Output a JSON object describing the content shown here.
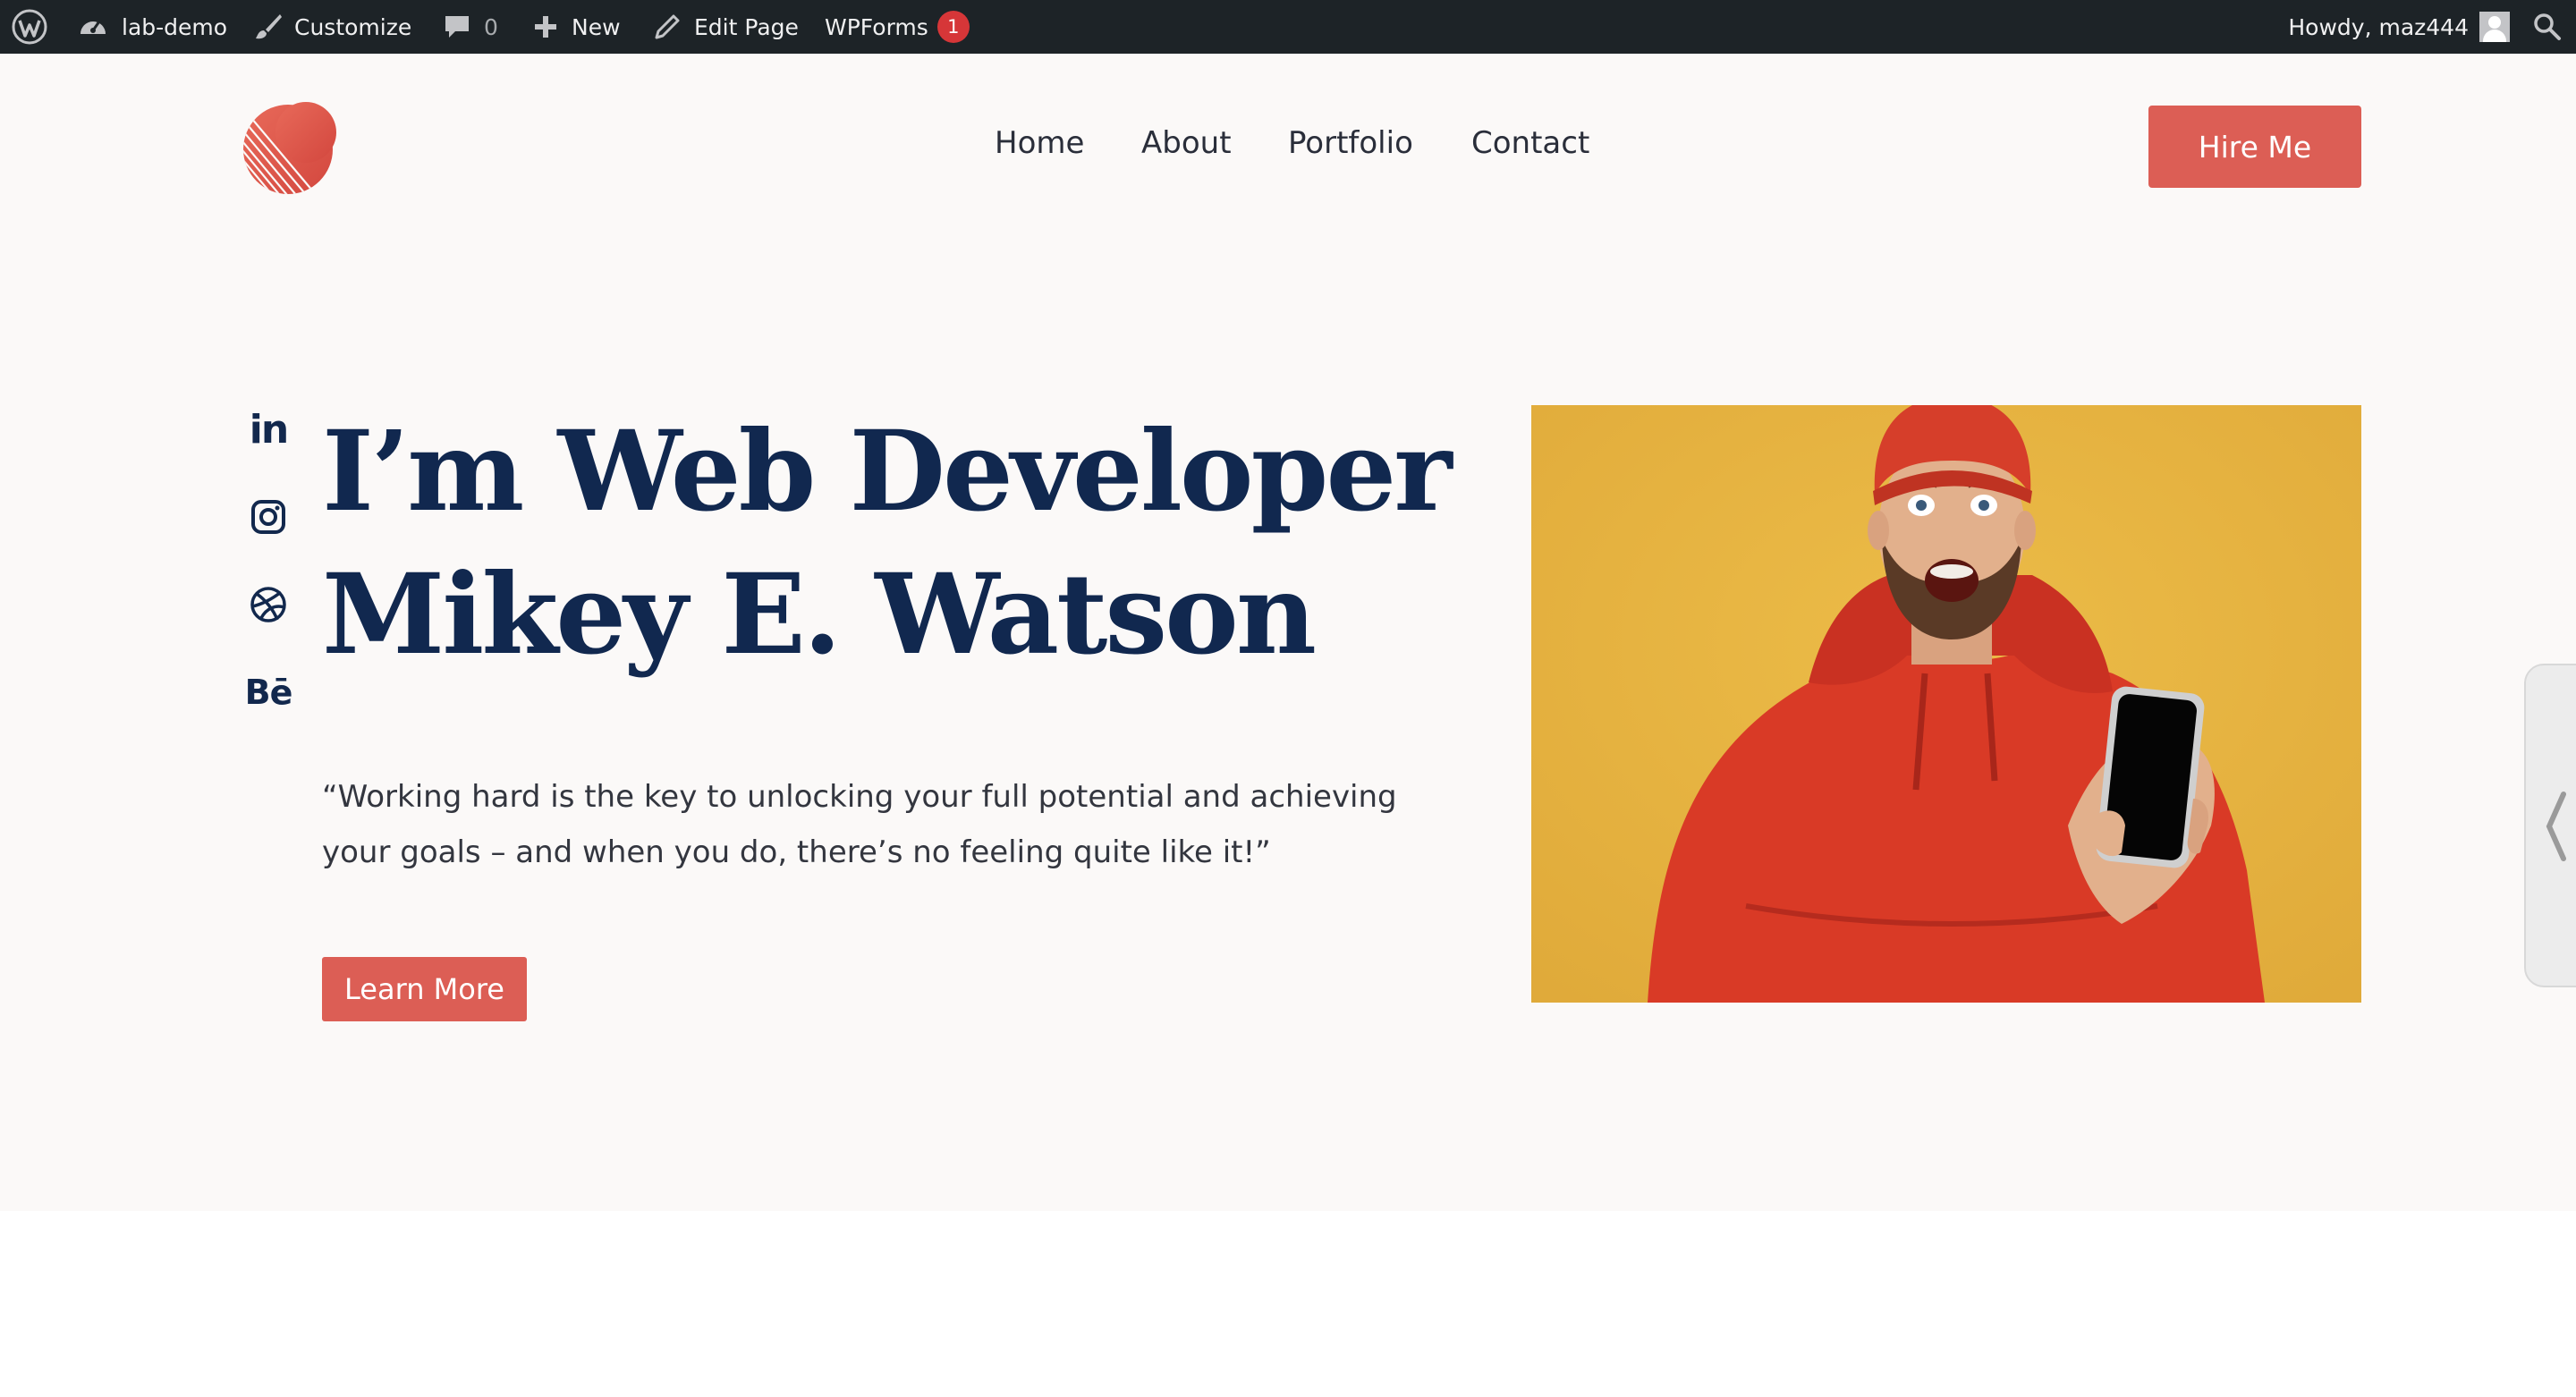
{
  "admin_bar": {
    "site_name": "lab-demo",
    "customize": "Customize",
    "comments_count": "0",
    "new": "New",
    "edit_page": "Edit Page",
    "wpforms": "WPForms",
    "wpforms_badge": "1",
    "howdy": "Howdy, maz444"
  },
  "header": {
    "nav": [
      "Home",
      "About",
      "Portfolio",
      "Contact"
    ],
    "cta": "Hire Me"
  },
  "hero": {
    "title_line1": "I’m Web Developer",
    "title_line2": "Mikey E. Watson",
    "quote": "“Working hard is the key to unlocking your full potential and achieving your goals – and when you do, there’s no feeling quite like it!”",
    "button": "Learn More",
    "socials": [
      "linkedin-icon",
      "instagram-icon",
      "dribbble-icon",
      "behance-icon"
    ],
    "linkedin_glyph": "in",
    "behance_glyph": "Bē"
  },
  "colors": {
    "admin_bar": "#1d2327",
    "accent": "#dc5e55",
    "heading": "#11284f",
    "page_bg": "#fbf9f8",
    "photo_bg": "#e7b43f",
    "hoodie": "#d93a26"
  }
}
